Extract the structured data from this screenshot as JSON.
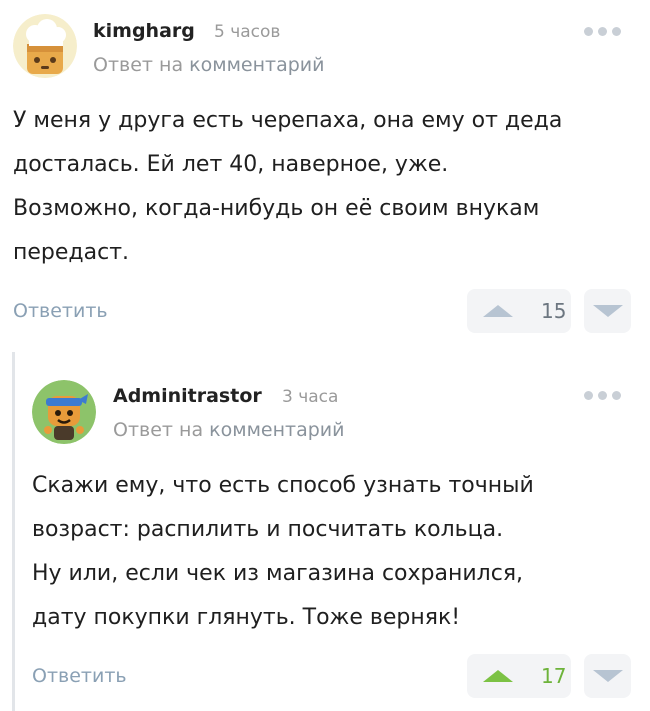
{
  "comments": [
    {
      "username": "kimgharg",
      "time": "5 часов",
      "reply_prefix": "Ответ на",
      "reply_link": "комментарий",
      "body": "У меня у друга есть черепаха, она ему от деда\nдосталась. Ей лет 40, наверное, уже.\nВозможно, когда-нибудь он её своим внукам\nпередаст.",
      "reply_label": "Ответить",
      "rating": "15",
      "upvoted": false,
      "avatar": "chef-hat-avatar",
      "colors": {
        "avatar_bg": "#f4e08a",
        "avatar_face": "#e8a94a"
      }
    },
    {
      "username": "Adminitrastor",
      "time": "3 часа",
      "reply_prefix": "Ответ на",
      "reply_link": "комментарий",
      "body": "Скажи ему, что есть способ узнать точный\nвозраст: распилить и посчитать кольца.\nНу или, если чек из магазина сохранился,\nдату покупки глянуть. Тоже верняк!",
      "reply_label": "Ответить",
      "rating": "17",
      "upvoted": true,
      "avatar": "ninja-avatar",
      "colors": {
        "avatar_bg": "#8dc36a",
        "upvote": "#7cc244"
      }
    }
  ]
}
